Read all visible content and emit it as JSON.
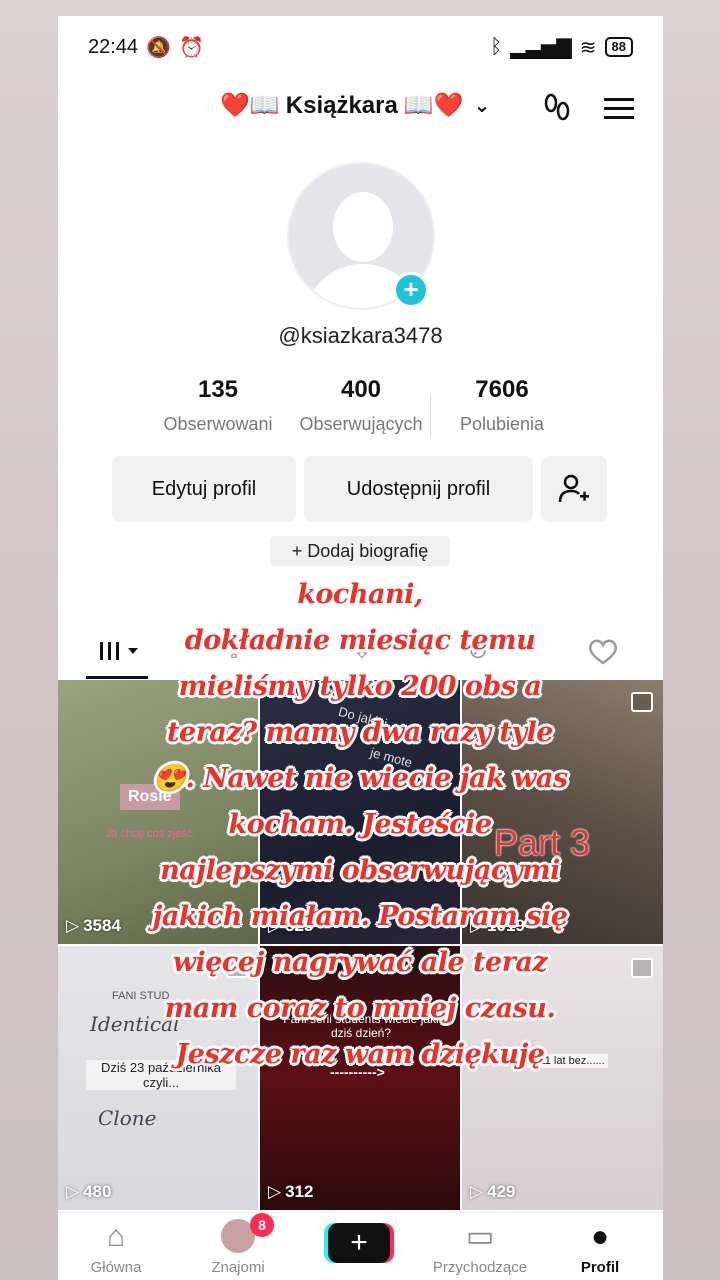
{
  "status": {
    "time": "22:44",
    "battery": "88"
  },
  "header": {
    "title": "Książkara",
    "title_emoji_left": "❤️📖",
    "title_emoji_right": "📖❤️"
  },
  "profile": {
    "handle": "@ksiazkara3478",
    "stats": [
      {
        "value": "135",
        "label": "Obserwowani"
      },
      {
        "value": "400",
        "label": "Obserwujących"
      },
      {
        "value": "7606",
        "label": "Polubienia"
      }
    ],
    "edit_label": "Edytuj profil",
    "share_label": "Udostępnij profil",
    "bio_label": "+ Dodaj biografię"
  },
  "grid": [
    {
      "views": "3584",
      "caption": "Rosie",
      "subcaption": "Ja chcę coś zjeść."
    },
    {
      "views": "325",
      "caption": "Do jakiej",
      "subcaption": "je mote"
    },
    {
      "views": "1019",
      "caption": "Part 3"
    },
    {
      "views": "480",
      "caption": "FANI STUD",
      "subcaption": "Dziś 23 października czyli..."
    },
    {
      "views": "312",
      "caption": "Fani serii students wiecie jaki dziś dzień?",
      "subcaption": "---------->"
    },
    {
      "views": "429",
      "caption": "Dziś 11 lat bez......"
    }
  ],
  "overlay": {
    "lines": [
      "kochani,",
      "dokładnie miesiąc temu",
      "mieliśmy tylko 200 obs a",
      "teraz? mamy dwa razy tyle",
      "😍. Nawet nie wiecie jak was",
      "kocham. Jesteście",
      "najlepszymi obserwującymi",
      "jakich miałam. Postaram się",
      "więcej nagrywać ale teraz",
      "mam coraz to mniej czasu.",
      "Jeszcze raz wam dziękuję"
    ]
  },
  "nav": {
    "items": [
      "Główna",
      "Znajomi",
      "Przychodzące",
      "Profil"
    ],
    "friends_badge": "8"
  }
}
